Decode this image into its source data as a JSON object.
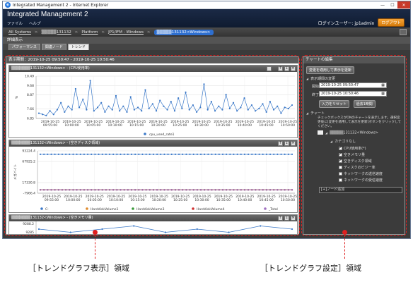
{
  "window": {
    "title": "Integrated Management 2 - Internet Explorer",
    "controls": [
      "—",
      "☐",
      "✕"
    ]
  },
  "app": {
    "title": "Integrated Management 2",
    "menu": [
      "ファイル",
      "ヘルプ"
    ],
    "user_label": "ログインユーザー: jp1admin",
    "logout": "ログアウト"
  },
  "breadcrumb": {
    "items": [
      "All Systems",
      "▒▒▒▒▒131132",
      "Platform",
      "JP1/IFM - Windows"
    ],
    "active": "▒▒▒▒▒131132<Windows>"
  },
  "section_title": "詳細表示",
  "tabs": [
    "パフォーマンス",
    "関連ノード",
    "トレンド"
  ],
  "period": "表示期間：2019-10-25 09:50:47 - 2019-10-25 10:50:46",
  "graphs": [
    {
      "title": "▒▒▒▒▒▒▒131132<Windows> - (CPU使用率)",
      "ylabel": "%"
    },
    {
      "title": "▒▒▒▒▒▒▒131132<Windows> - (空きディスク領域)",
      "ylabel": "メガバイト"
    },
    {
      "title": "▒▒▒▒▒▒▒131132<Windows> - (空きメモリ量)"
    }
  ],
  "graph_buttons": [
    "↑",
    "↓",
    "✕"
  ],
  "chart_data": [
    {
      "type": "line",
      "ylabel": "%",
      "yticks": [
        6.85,
        7.66,
        8.87,
        9.68,
        10.49
      ],
      "ylim": [
        6.85,
        10.49
      ],
      "xticks": [
        "2019-10-25\n09:55:00",
        "2019-10-25\n10:00:00",
        "2019-10-25\n10:05:00",
        "2019-10-25\n10:10:00",
        "2019-10-25\n10:15:00",
        "2019-10-25\n10:20:00",
        "2019-10-25\n10:25:00",
        "2019-10-25\n10:30:00",
        "2019-10-25\n10:35:00",
        "2019-10-25\n10:40:00",
        "2019-10-25\n10:45:00",
        "2019-10-25\n10:50:00"
      ],
      "series": [
        {
          "name": "cpu_used_rate1",
          "color": "#3a78c8",
          "values": [
            7.3,
            7.2,
            7.1,
            7.5,
            7.2,
            7.6,
            8.2,
            7.4,
            7.9,
            7.6,
            9.4,
            7.8,
            8.5,
            7.6,
            10.1,
            7.5,
            7.8,
            8.2,
            7.4,
            7.9,
            7.6,
            8.8,
            7.5,
            7.9,
            7.4,
            8.7,
            7.6,
            7.8,
            7.5,
            9.3,
            7.7,
            8.1,
            7.5,
            8.4,
            7.9,
            7.6,
            8.3,
            7.5,
            8.6,
            7.7,
            9.1,
            7.6,
            8.0,
            7.4,
            7.8,
            9.8,
            7.6,
            8.3,
            7.5,
            7.9,
            7.6,
            8.9,
            7.7,
            8.2,
            7.5,
            7.8,
            8.6,
            7.6,
            8.0,
            7.5,
            7.7,
            8.1,
            7.4,
            8.3,
            7.6,
            7.9,
            7.3,
            7.8,
            7.7,
            8.0
          ]
        }
      ]
    },
    {
      "type": "line",
      "ylabel": "メガバイト",
      "yticks": [
        -7966.4,
        17330.8,
        67925.2,
        93224.4
      ],
      "ylim": [
        -7966.4,
        93224.4
      ],
      "xticks": [
        "2019-10-25\n09:55:00",
        "2019-10-25\n10:00:00",
        "2019-10-25\n10:05:00",
        "2019-10-25\n10:10:00",
        "2019-10-25\n10:15:00",
        "2019-10-25\n10:20:00",
        "2019-10-25\n10:25:00",
        "2019-10-25\n10:30:00",
        "2019-10-25\n10:35:00",
        "2019-10-25\n10:40:00",
        "2019-10-25\n10:45:00",
        "2019-10-25\n10:50:00"
      ],
      "series": [
        {
          "name": "C:",
          "color": "#3a78c8",
          "values": [
            85000
          ]
        },
        {
          "name": "HarddiskVolume1",
          "color": "#e08a2a",
          "values": [
            0
          ]
        },
        {
          "name": "HarddiskVolume3",
          "color": "#3a9a3a",
          "values": [
            0
          ]
        },
        {
          "name": "HarddiskVolume4",
          "color": "#d03030",
          "values": [
            0
          ]
        },
        {
          "name": "_Total",
          "color": "#a070c0",
          "values": [
            0
          ]
        }
      ]
    },
    {
      "type": "line",
      "yticks": [
        9288.2,
        9285.0
      ],
      "series": [
        {
          "name": "",
          "color": "#3a78c8",
          "values": [
            9287,
            9286,
            9287,
            9288,
            9286,
            9287,
            9286,
            9288,
            9287
          ]
        }
      ]
    }
  ],
  "right": {
    "header": "チャートの編集",
    "apply_button": "変更を適用して表示を更新",
    "period_section": "表示期間の変更",
    "start_label": "開始",
    "start_value": "2019-10-25 09:50:47",
    "end_label": "終了",
    "end_value": "2019-10-25 10:50:46",
    "reset_button": "入力をリセット",
    "last_hour_button": "過去1時間",
    "chart_section": "チャート",
    "chart_desc": "チェックボックスがONのチャートを表示します。選択変更後に[変更を適用して表示を更新]ボタンをクリックしてください。",
    "node": "▒▒▒▒▒131132<Windows>",
    "category": "カテゴリなし",
    "items": [
      {
        "label": "CPU使用率(*)",
        "checked": true
      },
      {
        "label": "空きメモリ量",
        "checked": true
      },
      {
        "label": "空きディスク領域",
        "checked": true
      },
      {
        "label": "ディスクのビジー率",
        "checked": false
      },
      {
        "label": "ネットワークの送信速度",
        "checked": false
      },
      {
        "label": "ネットワークの受信速度",
        "checked": false
      }
    ],
    "add_node": "[+]ノード追加"
  },
  "callouts": {
    "left": "［トレンドグラフ表示］領域",
    "right": "［トレンドグラフ設定］領域"
  },
  "colors": {
    "accent": "#2e6fd0",
    "callout": "#e02020",
    "logout": "#f3a236"
  }
}
